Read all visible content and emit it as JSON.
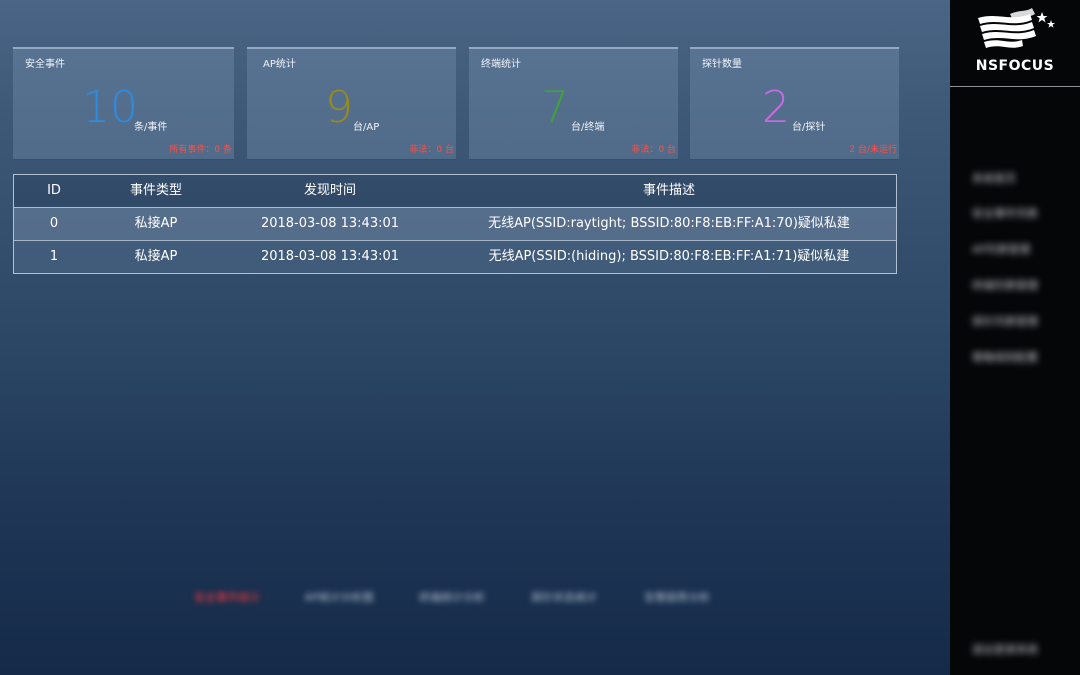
{
  "cards": [
    {
      "title": "安全事件",
      "value": "10",
      "unit": "条/事件",
      "footer": "所有事件：0 条",
      "color": "#2f8be0"
    },
    {
      "title": "AP统计",
      "value": "9",
      "unit": "台/AP",
      "footer": "非法：0 台",
      "color": "#9a8a18"
    },
    {
      "title": "终端统计",
      "value": "7",
      "unit": "台/终端",
      "footer": "非法：0 台",
      "color": "#3fa23a"
    },
    {
      "title": "探针数量",
      "value": "2",
      "unit": "台/探针",
      "footer": "2 台/未运行",
      "color": "#c66be0"
    }
  ],
  "table": {
    "headers": {
      "id": "ID",
      "type": "事件类型",
      "time": "发现时间",
      "desc": "事件描述"
    },
    "rows": [
      {
        "id": "0",
        "type": "私接AP",
        "time": "2018-03-08 13:43:01",
        "desc": "无线AP(SSID:raytight; BSSID:80:F8:EB:FF:A1:70)疑似私建"
      },
      {
        "id": "1",
        "type": "私接AP",
        "time": "2018-03-08 13:43:01",
        "desc": "无线AP(SSID:(hiding); BSSID:80:F8:EB:FF:A1:71)疑似私建"
      }
    ]
  },
  "bottom_tabs": [
    "安全事件统计",
    "AP统计分析图",
    "终端统计分析",
    "探针状态统计",
    "告警趋势分析"
  ],
  "sidebar": {
    "logo": "NSFOCUS",
    "items": [
      "系统首页",
      "安全事件列表",
      "AP列表管理",
      "终端列表管理",
      "探针列表管理",
      "策略规则配置"
    ],
    "footer": "退出登录系统"
  }
}
